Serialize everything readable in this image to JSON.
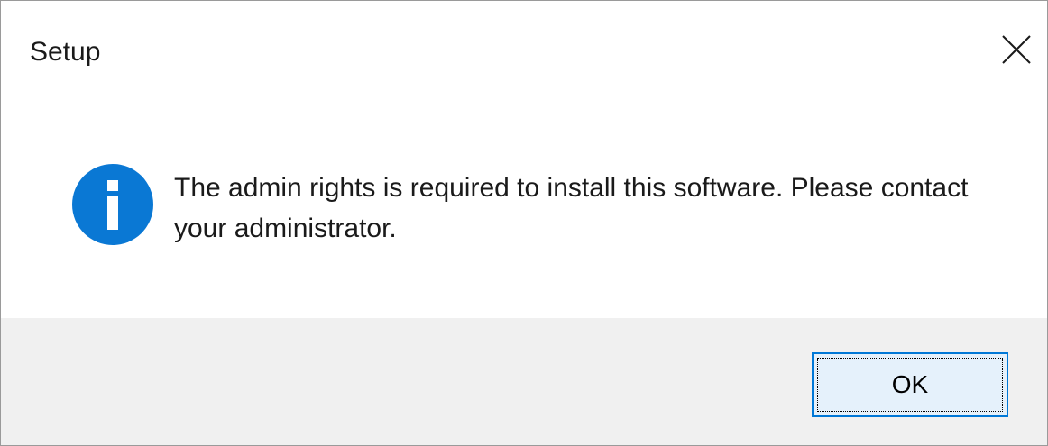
{
  "dialog": {
    "title": "Setup",
    "message": "The admin rights is required to install this software. Please contact your administrator.",
    "icon": "information-icon",
    "close_icon": "close-icon",
    "ok_label": "OK"
  },
  "colors": {
    "info_icon": "#0a78d4",
    "button_border": "#0078d7",
    "button_fill": "#e5f1fb",
    "footer_background": "#f0f0f0"
  }
}
